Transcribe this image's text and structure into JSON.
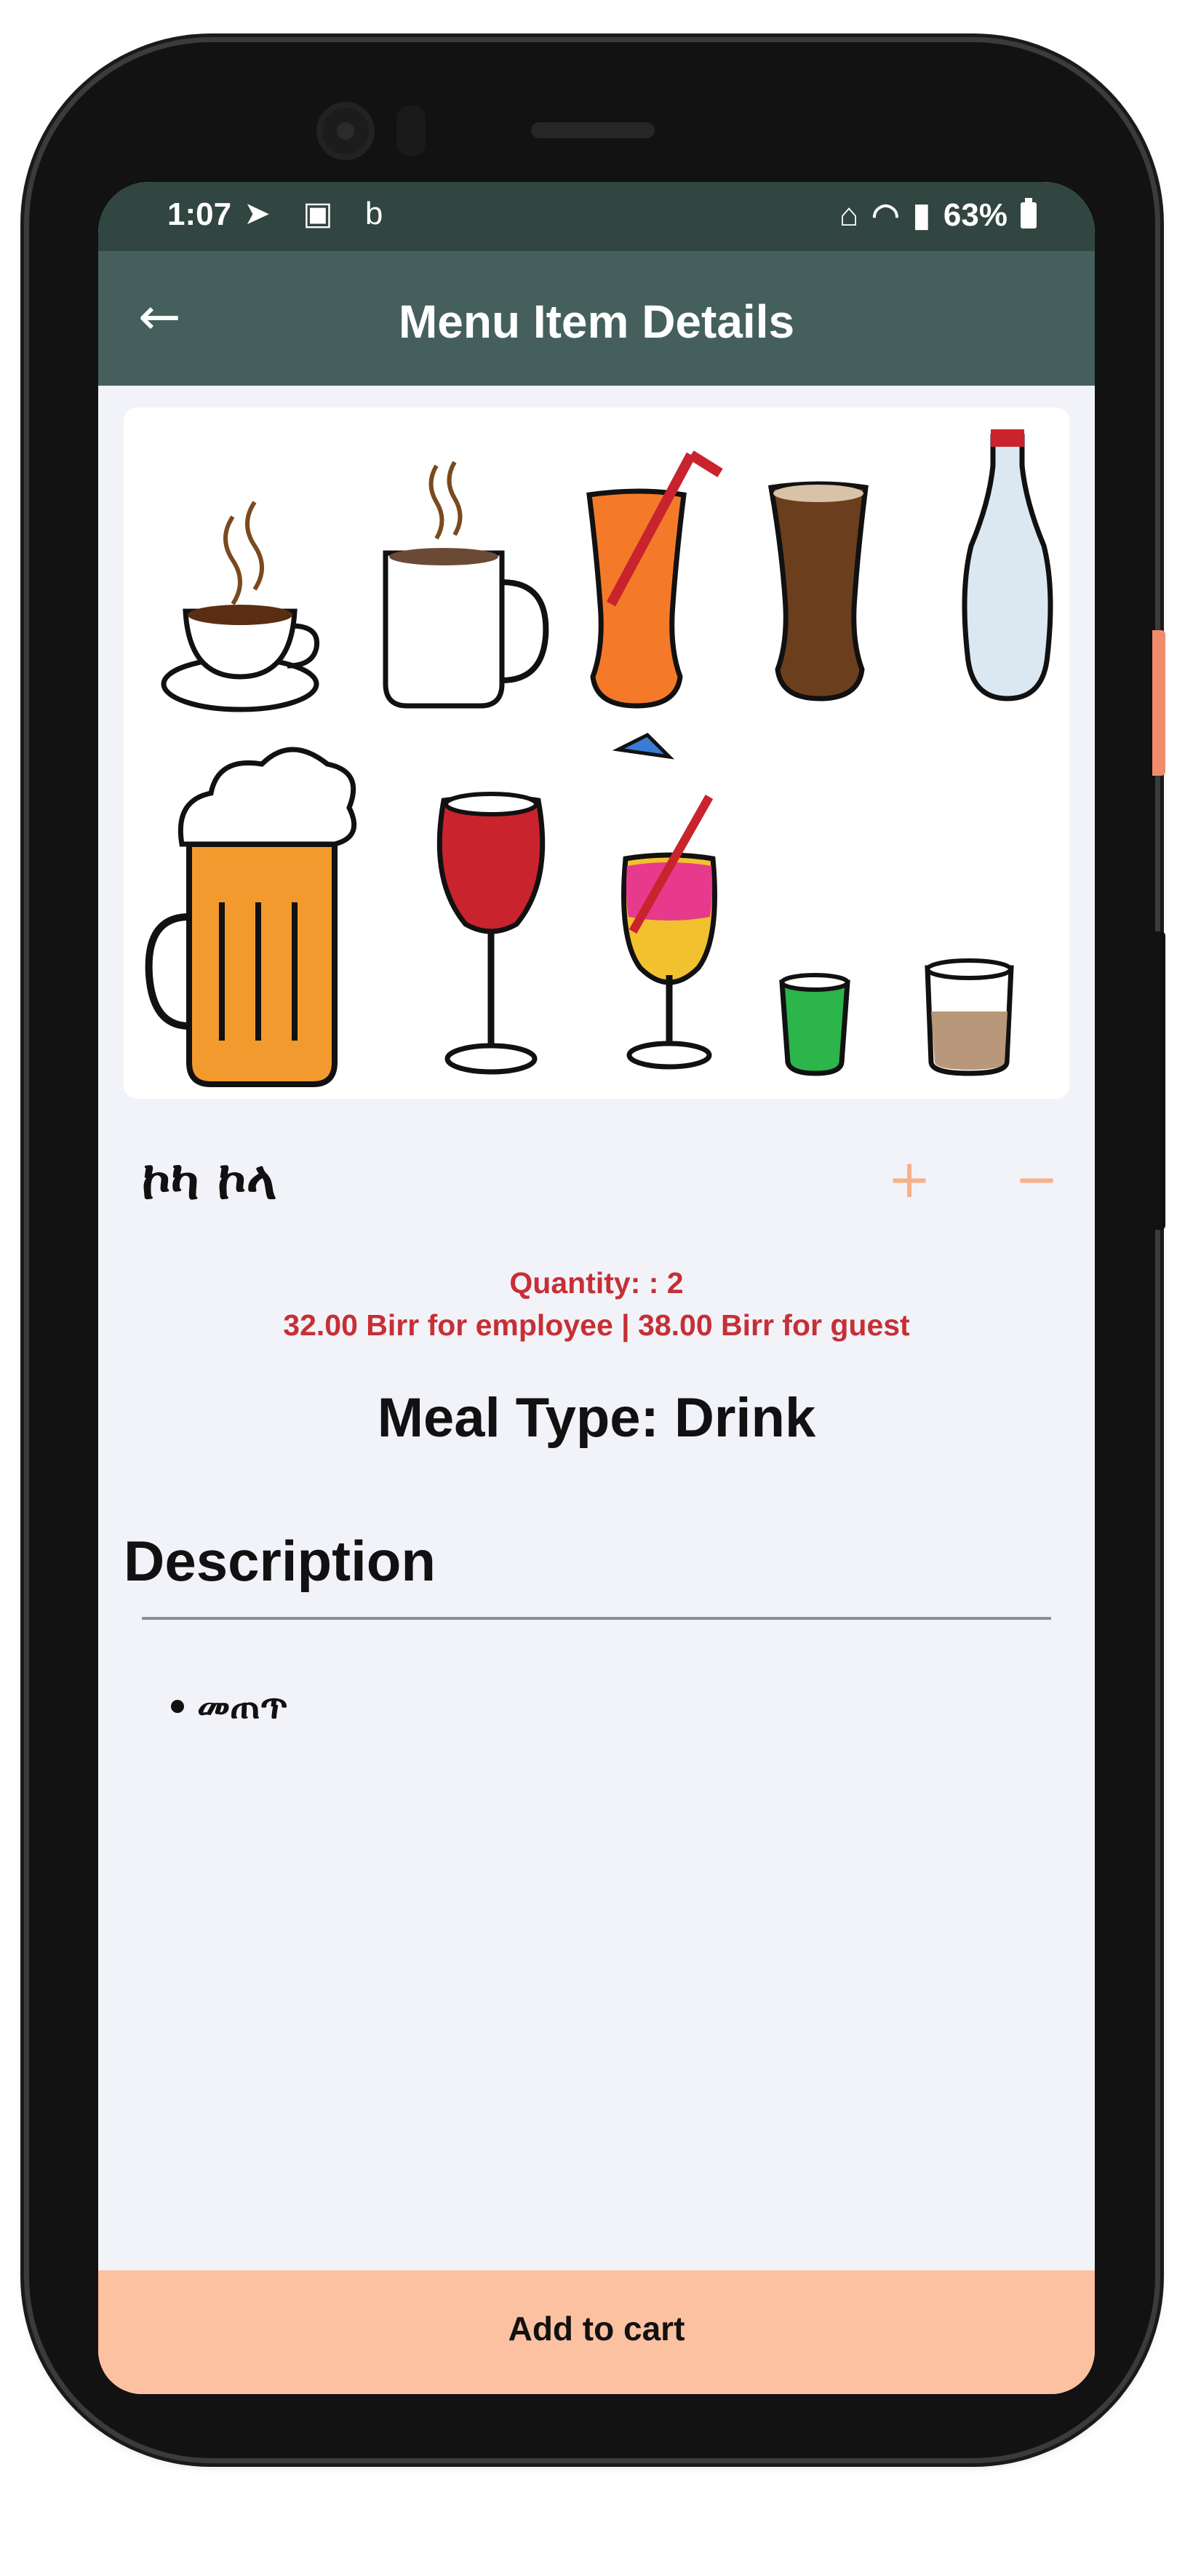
{
  "status_bar": {
    "time": "1:07",
    "notification_icons": [
      "telegram-icon",
      "gallery-icon",
      "b-app-icon"
    ],
    "battery": "63%"
  },
  "app_bar": {
    "back_icon": "arrow-left-icon",
    "title": "Menu Item Details"
  },
  "item": {
    "image_icons": [
      "coffee-cup-icon",
      "mug-icon",
      "orange-juice-icon",
      "cola-glass-icon",
      "water-bottle-icon",
      "beer-mug-icon",
      "wine-glass-icon",
      "cocktail-icon",
      "shot-glass-icon",
      "whiskey-glass-icon"
    ],
    "name": "ኮካ ኮላ",
    "plus_label": "+",
    "minus_label": "−",
    "quantity_text": "Quantity: : 2",
    "price_text": "32.00 Birr for employee | 38.00 Birr for guest",
    "meal_type_text": "Meal Type: Drink"
  },
  "description": {
    "heading": "Description",
    "items": [
      "መጠጥ"
    ]
  },
  "cart": {
    "label": "Add to cart"
  },
  "colors": {
    "status_bar": "#314541",
    "app_bar": "#45605c",
    "background": "#f2f3f8",
    "accent_price": "#c62f36",
    "cart_button": "#fcc1a1",
    "qty_buttons": "#f7b089"
  }
}
